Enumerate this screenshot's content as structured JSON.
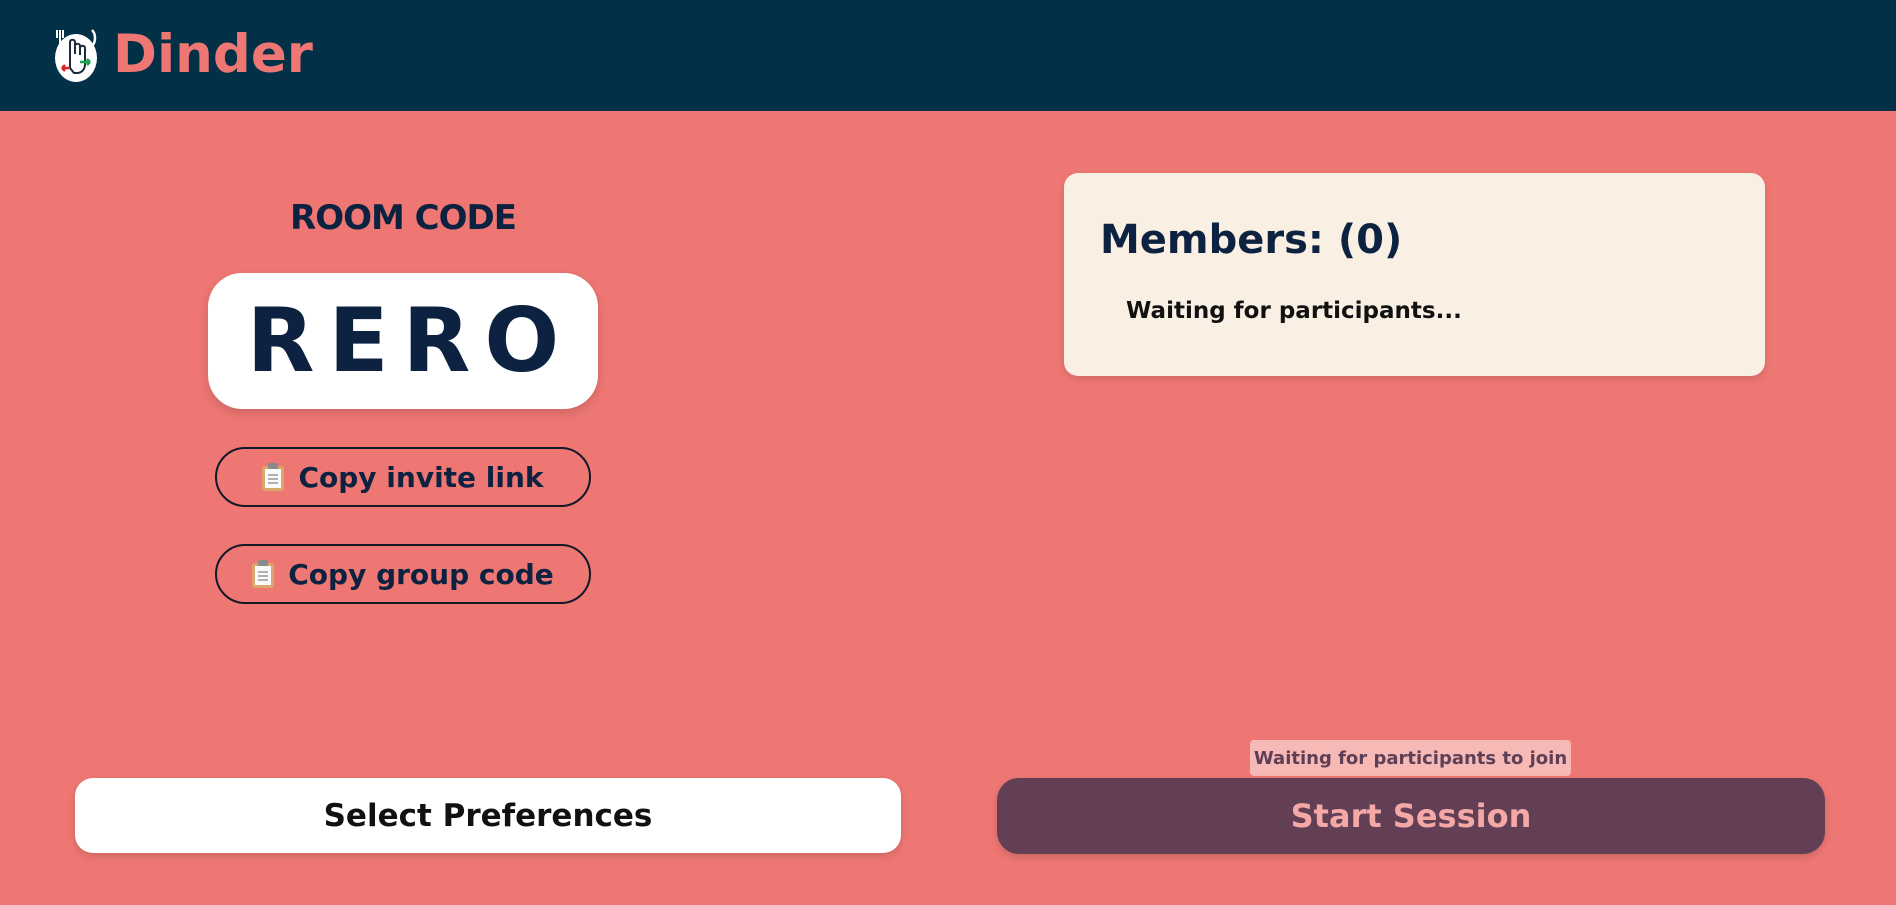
{
  "header": {
    "brand": "Dinder",
    "logo_icon": "hand-swipe-logo-icon"
  },
  "room": {
    "label": "ROOM CODE",
    "code": "RERO"
  },
  "actions": {
    "copy_invite_label": "Copy invite link",
    "copy_group_label": "Copy group code",
    "copy_icon": "clipboard-icon"
  },
  "members": {
    "title": "Members: (0)",
    "empty_text": "Waiting for participants..."
  },
  "footer": {
    "select_preferences_label": "Select Preferences",
    "start_session_label": "Start Session",
    "start_session_tooltip": "Waiting for participants to join"
  },
  "colors": {
    "background": "#ee7773",
    "header": "#023047",
    "navy_text": "#0d2240",
    "card": "#f9efe2",
    "start_button": "#623f55",
    "start_button_text": "#f5a9a7"
  }
}
